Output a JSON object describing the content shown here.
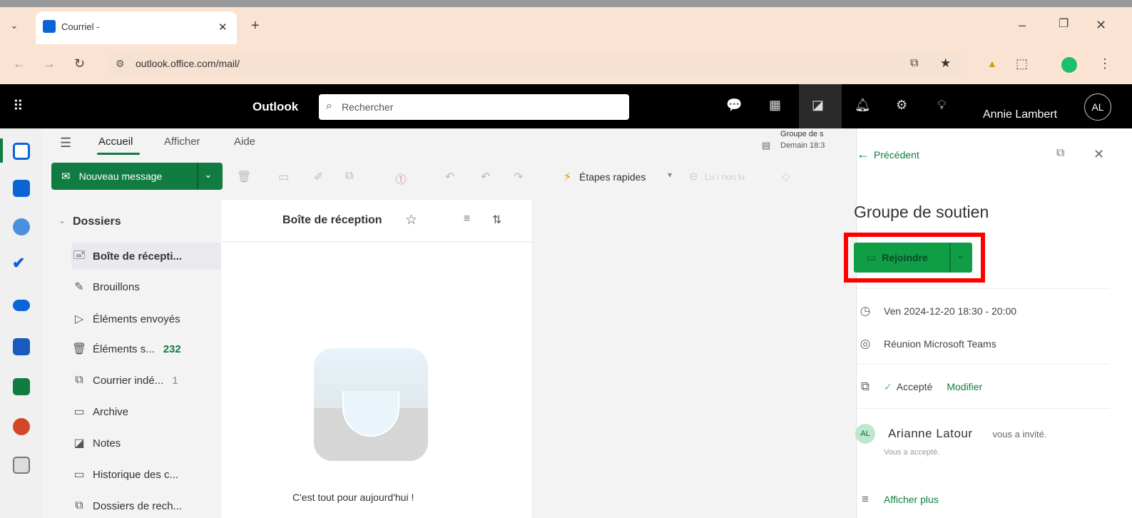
{
  "browser": {
    "tab_title": "Courriel - ",
    "new_tab": "+",
    "url": "outlook.office.com/mail/",
    "window_controls": {
      "minimize": "–",
      "restore": "❐",
      "close": "✕"
    }
  },
  "header": {
    "app_name": "Outlook",
    "search_placeholder": "Rechercher",
    "user_name": "Annie Lambert",
    "user_initials": "AL"
  },
  "ribbon": {
    "tabs": [
      "Accueil",
      "Afficher",
      "Aide"
    ],
    "new_message": "Nouveau message",
    "quick_steps": "Étapes rapides",
    "read_unread": "Lu / non lu",
    "reminder_title": "Groupe de s",
    "reminder_time": "Demain 18:3"
  },
  "folders": {
    "header": "Dossiers",
    "items": [
      {
        "label": "Boîte de récepti...",
        "count": ""
      },
      {
        "label": "Brouillons",
        "count": ""
      },
      {
        "label": "Éléments envoyés",
        "count": ""
      },
      {
        "label": "Éléments s...",
        "count": "232"
      },
      {
        "label": "Courrier indé...",
        "count": "1"
      },
      {
        "label": "Archive",
        "count": ""
      },
      {
        "label": "Notes",
        "count": ""
      },
      {
        "label": "Historique des c...",
        "count": ""
      },
      {
        "label": "Dossiers de rech...",
        "count": ""
      }
    ]
  },
  "message_list": {
    "title": "Boîte de réception",
    "empty_text": "C'est tout pour aujourd'hui !"
  },
  "event_pane": {
    "back_label": "Précédent",
    "title": "Groupe de soutien",
    "join_button": "Rejoindre",
    "datetime": "Ven 2024-12-20 18:30 - 20:00",
    "location": "Réunion Microsoft Teams",
    "status": "Accepté",
    "modify_link": "Modifier",
    "organizer_initials": "AL",
    "organizer_name": "Arianne Latour",
    "invite_text": "vous a invité.",
    "accepted_note": "Vous a accepté.",
    "show_more": "Afficher plus"
  },
  "colors": {
    "outlook_green": "#107c41",
    "join_green": "#0f9d45",
    "highlight_red": "#ff0000",
    "header_black": "#000000"
  }
}
